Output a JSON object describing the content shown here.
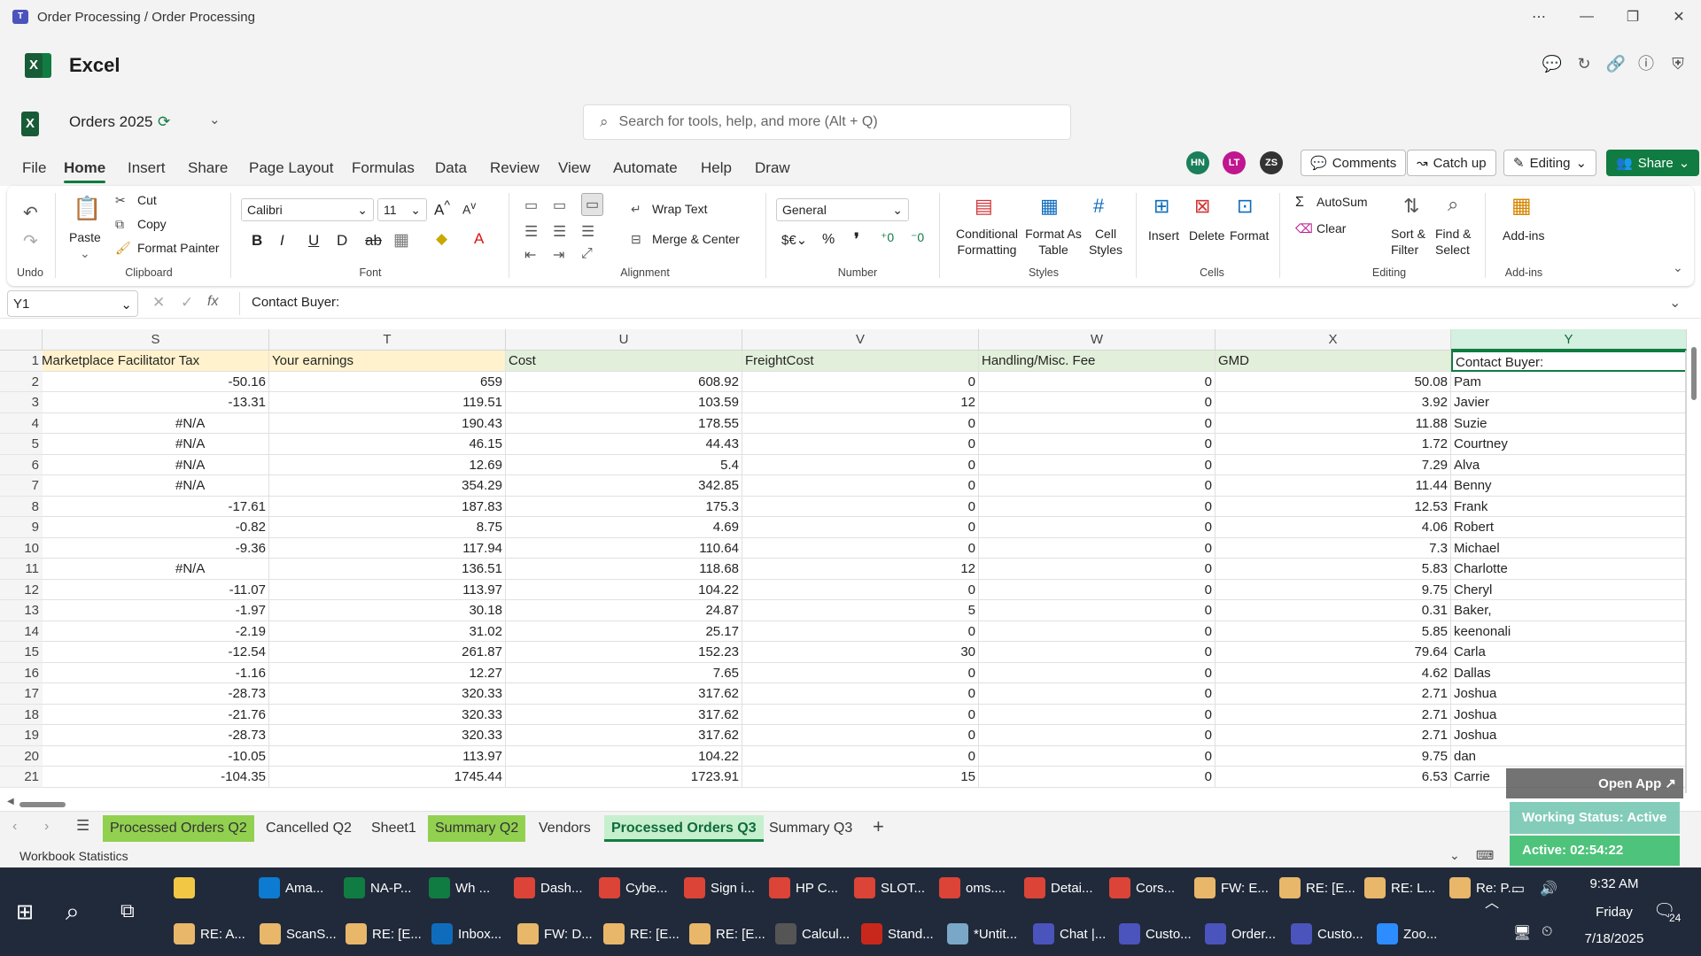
{
  "window": {
    "title": "Order Processing / Order Processing"
  },
  "app": {
    "name": "Excel"
  },
  "doc": {
    "name": "Orders 2025"
  },
  "search": {
    "placeholder": "Search for tools, help, and more (Alt + Q)"
  },
  "tabs": [
    "File",
    "Home",
    "Insert",
    "Share",
    "Page Layout",
    "Formulas",
    "Data",
    "Review",
    "View",
    "Automate",
    "Help",
    "Draw"
  ],
  "users": [
    {
      "initials": "HN",
      "color": "#1a7f5a"
    },
    {
      "initials": "LT",
      "color": "#c0168f"
    },
    {
      "initials": "ZS",
      "color": "#333333"
    }
  ],
  "actions": {
    "comments": "Comments",
    "catchup": "Catch up",
    "editing": "Editing",
    "share": "Share"
  },
  "ribbon": {
    "undo_label": "Undo",
    "paste": "Paste",
    "cut": "Cut",
    "copy": "Copy",
    "format_painter": "Format Painter",
    "clipboard": "Clipboard",
    "font_name": "Calibri",
    "font_size": "11",
    "font": "Font",
    "wrap_text": "Wrap Text",
    "merge_center": "Merge & Center",
    "alignment": "Alignment",
    "number_format": "General",
    "number": "Number",
    "cond_fmt_1": "Conditional",
    "cond_fmt_2": "Formatting",
    "fmt_table_1": "Format As",
    "fmt_table_2": "Table",
    "cell_styles_1": "Cell",
    "cell_styles_2": "Styles",
    "styles": "Styles",
    "insert": "Insert",
    "delete": "Delete",
    "format": "Format",
    "cells": "Cells",
    "autosum": "AutoSum",
    "clear": "Clear",
    "sort_1": "Sort &",
    "sort_2": "Filter",
    "find_1": "Find &",
    "find_2": "Select",
    "editing": "Editing",
    "addins": "Add-ins",
    "addins_group": "Add-ins"
  },
  "formula_bar": {
    "name_box": "Y1",
    "formula": "Contact Buyer:"
  },
  "columns": [
    "S",
    "T",
    "U",
    "V",
    "W",
    "X",
    "Y"
  ],
  "header_row": [
    "Marketplace Facilitator Tax",
    "Your earnings",
    "Cost",
    "FreightCost",
    "Handling/Misc. Fee",
    "GMD",
    "Contact Buyer:"
  ],
  "rows": [
    {
      "n": "2",
      "s": "-50.16",
      "t": "659",
      "u": "608.92",
      "v": "0",
      "w": "0",
      "x": "50.08",
      "y": "Pam"
    },
    {
      "n": "3",
      "s": "-13.31",
      "t": "119.51",
      "u": "103.59",
      "v": "12",
      "w": "0",
      "x": "3.92",
      "y": "Javier"
    },
    {
      "n": "4",
      "s": "#N/A",
      "t": "190.43",
      "u": "178.55",
      "v": "0",
      "w": "0",
      "x": "11.88",
      "y": "Suzie"
    },
    {
      "n": "5",
      "s": "#N/A",
      "t": "46.15",
      "u": "44.43",
      "v": "0",
      "w": "0",
      "x": "1.72",
      "y": "Courtney"
    },
    {
      "n": "6",
      "s": "#N/A",
      "t": "12.69",
      "u": "5.4",
      "v": "0",
      "w": "0",
      "x": "7.29",
      "y": "Alva"
    },
    {
      "n": "7",
      "s": "#N/A",
      "t": "354.29",
      "u": "342.85",
      "v": "0",
      "w": "0",
      "x": "11.44",
      "y": "Benny"
    },
    {
      "n": "8",
      "s": "-17.61",
      "t": "187.83",
      "u": "175.3",
      "v": "0",
      "w": "0",
      "x": "12.53",
      "y": "Frank"
    },
    {
      "n": "9",
      "s": "-0.82",
      "t": "8.75",
      "u": "4.69",
      "v": "0",
      "w": "0",
      "x": "4.06",
      "y": "Robert"
    },
    {
      "n": "10",
      "s": "-9.36",
      "t": "117.94",
      "u": "110.64",
      "v": "0",
      "w": "0",
      "x": "7.3",
      "y": "Michael"
    },
    {
      "n": "11",
      "s": "#N/A",
      "t": "136.51",
      "u": "118.68",
      "v": "12",
      "w": "0",
      "x": "5.83",
      "y": "Charlotte"
    },
    {
      "n": "12",
      "s": "-11.07",
      "t": "113.97",
      "u": "104.22",
      "v": "0",
      "w": "0",
      "x": "9.75",
      "y": "Cheryl"
    },
    {
      "n": "13",
      "s": "-1.97",
      "t": "30.18",
      "u": "24.87",
      "v": "5",
      "w": "0",
      "x": "0.31",
      "y": "Baker,"
    },
    {
      "n": "14",
      "s": "-2.19",
      "t": "31.02",
      "u": "25.17",
      "v": "0",
      "w": "0",
      "x": "5.85",
      "y": "keenonali"
    },
    {
      "n": "15",
      "s": "-12.54",
      "t": "261.87",
      "u": "152.23",
      "v": "30",
      "w": "0",
      "x": "79.64",
      "y": "Carla"
    },
    {
      "n": "16",
      "s": "-1.16",
      "t": "12.27",
      "u": "7.65",
      "v": "0",
      "w": "0",
      "x": "4.62",
      "y": "Dallas"
    },
    {
      "n": "17",
      "s": "-28.73",
      "t": "320.33",
      "u": "317.62",
      "v": "0",
      "w": "0",
      "x": "2.71",
      "y": "Joshua"
    },
    {
      "n": "18",
      "s": "-21.76",
      "t": "320.33",
      "u": "317.62",
      "v": "0",
      "w": "0",
      "x": "2.71",
      "y": "Joshua"
    },
    {
      "n": "19",
      "s": "-28.73",
      "t": "320.33",
      "u": "317.62",
      "v": "0",
      "w": "0",
      "x": "2.71",
      "y": "Joshua"
    },
    {
      "n": "20",
      "s": "-10.05",
      "t": "113.97",
      "u": "104.22",
      "v": "0",
      "w": "0",
      "x": "9.75",
      "y": "dan"
    },
    {
      "n": "21",
      "s": "-104.35",
      "t": "1745.44",
      "u": "1723.91",
      "v": "15",
      "w": "0",
      "x": "6.53",
      "y": "Carrie"
    }
  ],
  "sheets": [
    {
      "name": "Processed Orders Q2",
      "style": "green"
    },
    {
      "name": "Cancelled Q2",
      "style": "plain"
    },
    {
      "name": "Sheet1",
      "style": "plain"
    },
    {
      "name": "Summary Q2",
      "style": "green"
    },
    {
      "name": "Vendors",
      "style": "plain"
    },
    {
      "name": "Processed Orders Q3",
      "style": "active"
    },
    {
      "name": "Summary Q3",
      "style": "plain"
    }
  ],
  "status": {
    "left": "Workbook Statistics"
  },
  "popup": {
    "open_app": "Open App ↗",
    "working": "Working Status: Active",
    "active": "Active: 02:54:22"
  },
  "taskbar": {
    "row1": [
      {
        "label": "",
        "color": "#f2c744"
      },
      {
        "label": "Ama...",
        "color": "#0c7bd1"
      },
      {
        "label": "NA-P...",
        "color": "#107c41"
      },
      {
        "label": "Wh ...",
        "color": "#107c41"
      },
      {
        "label": "Dash...",
        "color": "#db4437"
      },
      {
        "label": "Cybe...",
        "color": "#db4437"
      },
      {
        "label": "Sign i...",
        "color": "#db4437"
      },
      {
        "label": "HP C...",
        "color": "#db4437"
      },
      {
        "label": "SLOT...",
        "color": "#db4437"
      },
      {
        "label": "oms....",
        "color": "#db4437"
      },
      {
        "label": "Detai...",
        "color": "#db4437"
      },
      {
        "label": "Cors...",
        "color": "#db4437"
      },
      {
        "label": "FW: E...",
        "color": "#e8b76a"
      },
      {
        "label": "RE: [E...",
        "color": "#e8b76a"
      },
      {
        "label": "RE: L...",
        "color": "#e8b76a"
      },
      {
        "label": "Re: P...",
        "color": "#e8b76a"
      }
    ],
    "row2": [
      {
        "label": "RE: A...",
        "color": "#e8b76a"
      },
      {
        "label": "ScanS...",
        "color": "#e8b76a"
      },
      {
        "label": "RE: [E...",
        "color": "#e8b76a"
      },
      {
        "label": "Inbox...",
        "color": "#0f6cbd"
      },
      {
        "label": "FW: D...",
        "color": "#e8b76a"
      },
      {
        "label": "RE: [E...",
        "color": "#e8b76a"
      },
      {
        "label": "RE: [E...",
        "color": "#e8b76a"
      },
      {
        "label": "Calcul...",
        "color": "#555555"
      },
      {
        "label": "Stand...",
        "color": "#c8281b"
      },
      {
        "label": "*Untit...",
        "color": "#7aa7c7"
      },
      {
        "label": "Chat |...",
        "color": "#4b53bc"
      },
      {
        "label": "Custo...",
        "color": "#4b53bc"
      },
      {
        "label": "Order...",
        "color": "#4b53bc"
      },
      {
        "label": "Custo...",
        "color": "#4b53bc"
      },
      {
        "label": "Zoo...",
        "color": "#2d8cff"
      }
    ],
    "clock": {
      "time": "9:32 AM",
      "day": "Friday",
      "date": "7/18/2025"
    },
    "notif": "24"
  }
}
